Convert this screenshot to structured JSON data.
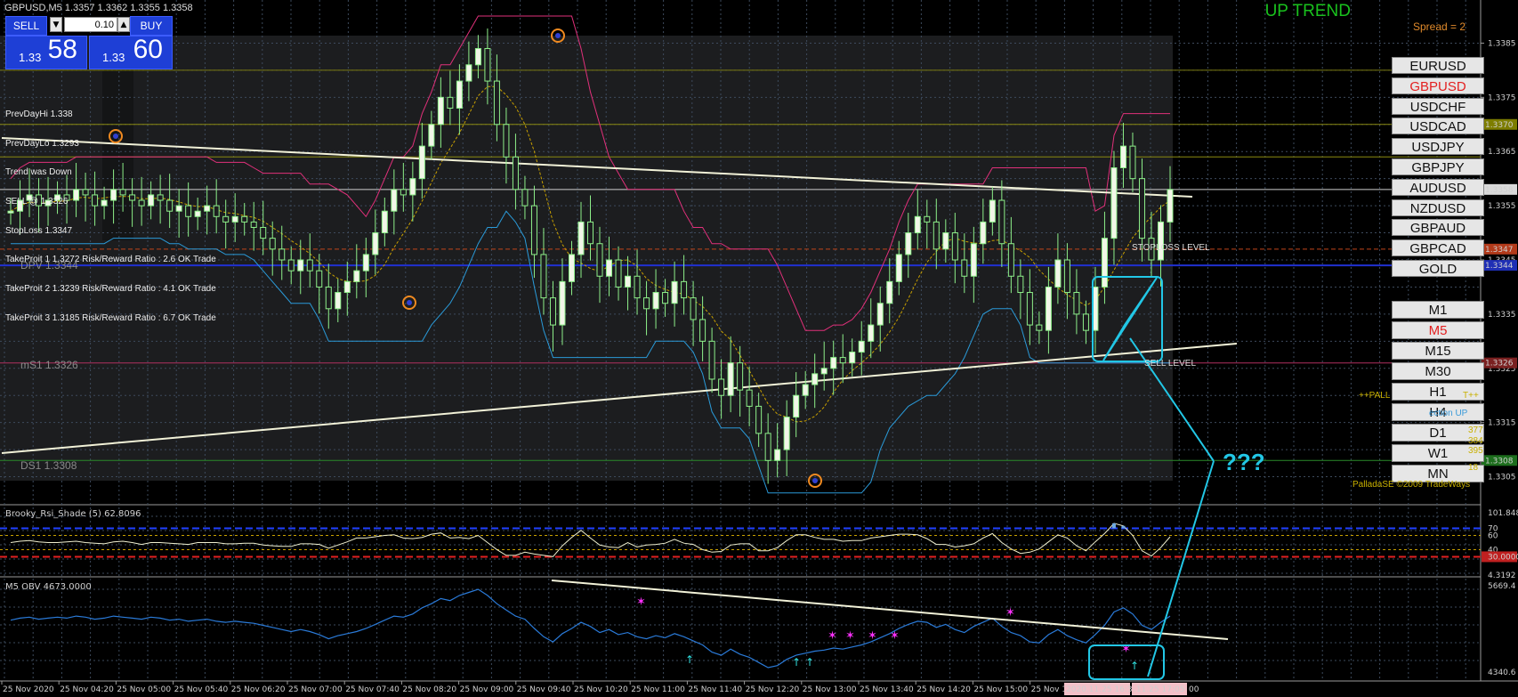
{
  "window": {
    "title": "GBPUSD,M5  1.3357 1.3362 1.3355 1.3358",
    "trend_label": "UP TREND",
    "spread_label": "Spread = 2",
    "signature": "PalladaSE ©2009 TradeWays",
    "pallada_label": "++PALL",
    "pallada_label_tail": "T++",
    "direction_label": "ection  UP",
    "question_marks": "???"
  },
  "trade_panel": {
    "sell_label": "SELL",
    "buy_label": "BUY",
    "lot_value": "0.10",
    "stepper_down": "▼",
    "stepper_up": "▲",
    "bid_small": "1.33",
    "bid_big": "58",
    "ask_small": "1.33",
    "ask_big": "60"
  },
  "info_lines": [
    "PrevDayHi 1.338",
    "PrevDayLo 1.3293",
    "Trend was Down",
    "SELL @ 1.3326",
    "StopLoss 1.3347",
    "TakeProit 1 1.3272 Risk/Reward Ratio : 2.6 OK Trade",
    "TakeProit 2 1.3239 Risk/Reward Ratio : 4.1 OK Trade",
    "TakeProit 3 1.3185 Risk/Reward Ratio : 6.7 OK Trade"
  ],
  "level_labels": {
    "dpv": "DPV  1.3344",
    "ms1": "mS1  1.3326",
    "ds1": "DS1  1.3308",
    "stoploss": "STOPLOSS LEVEL",
    "sell": "SELL LEVEL"
  },
  "symbols": [
    {
      "label": "EURUSD",
      "active": false
    },
    {
      "label": "GBPUSD",
      "active": true
    },
    {
      "label": "USDCHF",
      "active": false
    },
    {
      "label": "USDCAD",
      "active": false
    },
    {
      "label": "USDJPY",
      "active": false
    },
    {
      "label": "GBPJPY",
      "active": false
    },
    {
      "label": "AUDUSD",
      "active": false
    },
    {
      "label": "NZDUSD",
      "active": false
    },
    {
      "label": "GBPAUD",
      "active": false
    },
    {
      "label": "GBPCAD",
      "active": false
    },
    {
      "label": "GOLD",
      "active": false
    }
  ],
  "timeframes": [
    {
      "label": "M1",
      "active": false
    },
    {
      "label": "M5",
      "active": true
    },
    {
      "label": "M15",
      "active": false
    },
    {
      "label": "M30",
      "active": false
    },
    {
      "label": "H1",
      "active": false
    },
    {
      "label": "H4",
      "active": false
    },
    {
      "label": "D1",
      "active": false
    },
    {
      "label": "W1",
      "active": false
    },
    {
      "label": "MN",
      "active": false
    }
  ],
  "side_values": [
    "377",
    "384",
    "395",
    "18"
  ],
  "price_axis": {
    "ticks": [
      "1.3385",
      "1.3375",
      "1.3365",
      "1.3355",
      "1.3345",
      "1.3335",
      "1.3325",
      "1.3315",
      "1.3305"
    ],
    "markers": [
      {
        "label": "1.3370",
        "color": "#7d7d00"
      },
      {
        "label": "1.3358",
        "color": "#d9d9d9"
      },
      {
        "label": "1.3347",
        "color": "#b23a1a"
      },
      {
        "label": "1.3344",
        "color": "#1f2fb5"
      },
      {
        "label": "1.3326",
        "color": "#7a2020"
      },
      {
        "label": "1.3308",
        "color": "#1d6e1d"
      }
    ]
  },
  "rsi_panel": {
    "title": "Brooky_Rsi_Shade (5) 62.8096",
    "ticks": [
      "101.8486",
      "70",
      "60",
      "40",
      "30.0000",
      "4.3192"
    ]
  },
  "obv_panel": {
    "title": "M5 OBV  4673.0000",
    "ticks": [
      "5669.4",
      "4340.6"
    ]
  },
  "time_axis": {
    "labels": [
      "25 Nov 2020",
      "25 Nov 04:20",
      "25 Nov 05:00",
      "25 Nov 05:40",
      "25 Nov 06:20",
      "25 Nov 07:00",
      "25 Nov 07:40",
      "25 Nov 08:20",
      "25 Nov 09:00",
      "25 Nov 09:40",
      "25 Nov 10:20",
      "25 Nov 11:00",
      "25 Nov 11:40",
      "25 Nov 12:20",
      "25 Nov 13:00",
      "25 Nov 13:40",
      "25 Nov 14:20",
      "25 Nov 15:00",
      "25 Nov 15"
    ],
    "highlight_1": "2020.11.25 16:30",
    "highlight_2": ".11.25 17:05",
    "tail": "00"
  },
  "chart_data": {
    "type": "candlestick",
    "symbol": "GBPUSD",
    "timeframe": "M5",
    "ylim": [
      1.33,
      1.339
    ],
    "close_series": [
      1.3354,
      1.3356,
      1.3357,
      1.3355,
      1.3356,
      1.3357,
      1.3356,
      1.3358,
      1.3357,
      1.3355,
      1.3356,
      1.3358,
      1.3357,
      1.3356,
      1.3355,
      1.3357,
      1.3356,
      1.3354,
      1.3355,
      1.3353,
      1.3354,
      1.3355,
      1.3353,
      1.3352,
      1.3353,
      1.3352,
      1.3351,
      1.3349,
      1.3347,
      1.3345,
      1.3343,
      1.3345,
      1.3343,
      1.334,
      1.3336,
      1.3339,
      1.3341,
      1.3343,
      1.3346,
      1.335,
      1.3354,
      1.3358,
      1.3357,
      1.336,
      1.3366,
      1.337,
      1.3375,
      1.3373,
      1.3378,
      1.3381,
      1.3384,
      1.3378,
      1.337,
      1.3364,
      1.3358,
      1.3355,
      1.3346,
      1.3338,
      1.3333,
      1.3341,
      1.3346,
      1.3352,
      1.3348,
      1.3342,
      1.3345,
      1.334,
      1.3342,
      1.3338,
      1.3336,
      1.3339,
      1.3337,
      1.3341,
      1.3338,
      1.3334,
      1.333,
      1.3323,
      1.332,
      1.3326,
      1.3321,
      1.3318,
      1.3313,
      1.3308,
      1.331,
      1.3316,
      1.332,
      1.3322,
      1.3324,
      1.3325,
      1.3327,
      1.3326,
      1.3328,
      1.333,
      1.3333,
      1.3337,
      1.3341,
      1.3346,
      1.335,
      1.3353,
      1.3352,
      1.3347,
      1.335,
      1.3345,
      1.3342,
      1.3348,
      1.3352,
      1.3356,
      1.3348,
      1.3342,
      1.3339,
      1.3333,
      1.3332,
      1.334,
      1.3345,
      1.3339,
      1.3335,
      1.3332,
      1.334,
      1.3349,
      1.3362,
      1.3366,
      1.336,
      1.3349,
      1.3345,
      1.3352,
      1.3358
    ]
  }
}
